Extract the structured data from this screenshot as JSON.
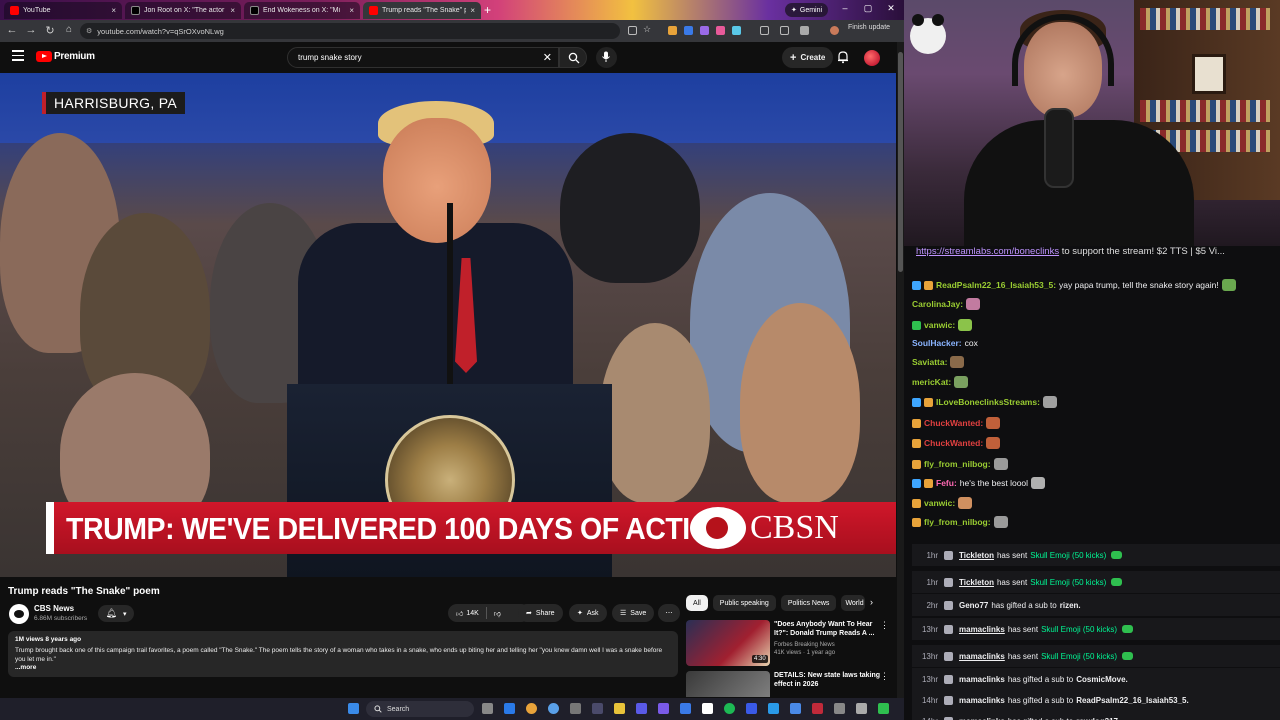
{
  "browser": {
    "tabs": [
      {
        "title": "YouTube",
        "favicon_color": "#ff0000"
      },
      {
        "title": "Jon Root on X: \"The actor",
        "favicon_color": "#000000"
      },
      {
        "title": "End Wokeness on X: \"Mi",
        "favicon_color": "#000000"
      },
      {
        "title": "Trump reads \"The Snake\" p",
        "favicon_color": "#ff0000"
      }
    ],
    "new_tab": "+",
    "gemini_label": "Gemini",
    "url": "youtube.com/watch?v=qSrOXvoNLwg",
    "finish_update": "Finish update"
  },
  "youtube": {
    "brand": "Premium",
    "search_query": "trump snake story",
    "create_label": "Create",
    "video": {
      "location": "HARRISBURG, PA",
      "lower_third": "TRUMP: WE'VE DELIVERED 100 DAYS OF ACTION",
      "network": "CBSN"
    },
    "title": "Trump reads \"The Snake\" poem",
    "channel": {
      "name": "CBS News",
      "subs": "6.86M subscribers"
    },
    "actions": {
      "likes": "14K",
      "share": "Share",
      "ask": "Ask",
      "save": "Save"
    },
    "description": {
      "meta": "1M views  8 years ago",
      "text": "Trump brought back one of this campaign trail favorites, a poem called \"The Snake.\" The poem tells the story of a woman who takes in a snake, who ends up biting her and telling her \"you knew damn well I was a snake before you let me in.\"",
      "more": "...more"
    },
    "chips": [
      "All",
      "Public speaking",
      "Politics News",
      "World"
    ],
    "recommendations": [
      {
        "title": "\"Does Anybody Want To Hear It?\": Donald Trump Reads A ...",
        "channel": "Forbes Breaking News",
        "views": "41K views · 1 year ago",
        "duration": "4:30"
      },
      {
        "title": "DETAILS: New state laws taking effect in 2026",
        "channel": "",
        "views": "",
        "duration": ""
      }
    ]
  },
  "taskbar": {
    "search_label": "Search"
  },
  "chat": {
    "pinned_link": "https://streamlabs.com/boneclinks",
    "pinned_rest": " to support the stream! $2 TTS | $5 Vi...",
    "messages": [
      {
        "user": "ReadPsalm22_16_Isaiah53_5",
        "color": "#9acd32",
        "text": "yay papa trump, tell the snake story again!",
        "badges": [
          "#3ea6ff",
          "#e8a33a"
        ]
      },
      {
        "user": "CarolinaJay",
        "color": "#9acd32",
        "text": "",
        "badges": []
      },
      {
        "user": "vanwic",
        "color": "#9acd32",
        "text": "",
        "badges": [
          "#2fbf4f"
        ]
      },
      {
        "user": "SoulHacker",
        "color": "#8ab4ff",
        "text": "cox",
        "badges": []
      },
      {
        "user": "Saviatta",
        "color": "#9acd32",
        "text": "",
        "badges": []
      },
      {
        "user": "mericKat",
        "color": "#9acd32",
        "text": "",
        "badges": []
      },
      {
        "user": "ILoveBoneclinksStreams",
        "color": "#9acd32",
        "text": "",
        "badges": [
          "#3ea6ff",
          "#e8a33a"
        ]
      },
      {
        "user": "ChuckWanted",
        "color": "#e04040",
        "text": "",
        "badges": [
          "#e8a33a"
        ]
      },
      {
        "user": "ChuckWanted",
        "color": "#e04040",
        "text": "",
        "badges": [
          "#e8a33a"
        ]
      },
      {
        "user": "fly_from_nilbog",
        "color": "#9acd32",
        "text": "",
        "badges": [
          "#e8a33a"
        ]
      },
      {
        "user": "Fefu",
        "color": "#ff69b4",
        "text": "he's the best loool",
        "badges": [
          "#3ea6ff",
          "#e8a33a"
        ]
      },
      {
        "user": "vanwic",
        "color": "#9acd32",
        "text": "",
        "badges": [
          "#e8a33a"
        ]
      },
      {
        "user": "fly_from_nilbog",
        "color": "#9acd32",
        "text": "",
        "badges": [
          "#e8a33a"
        ]
      }
    ],
    "events": [
      {
        "time": "1hr",
        "user": "Tickleton",
        "link": true,
        "pre": "has sent",
        "highlight": "Skull Emoji (50 kicks)",
        "after": "",
        "gem": true
      },
      {
        "time": "1hr",
        "user": "Tickleton",
        "link": true,
        "pre": "has sent",
        "highlight": "Skull Emoji (50 kicks)",
        "after": "",
        "gem": true
      },
      {
        "time": "2hr",
        "user": "Geno77",
        "link": false,
        "pre": "has gifted a sub to",
        "highlight": "",
        "after": "rizen.",
        "gem": false
      },
      {
        "time": "13hr",
        "user": "mamaclinks",
        "link": true,
        "pre": "has sent",
        "highlight": "Skull Emoji (50 kicks)",
        "after": "",
        "gem": true
      },
      {
        "time": "13hr",
        "user": "mamaclinks",
        "link": true,
        "pre": "has sent",
        "highlight": "Skull Emoji (50 kicks)",
        "after": "",
        "gem": true
      },
      {
        "time": "13hr",
        "user": "mamaclinks",
        "link": false,
        "pre": "has gifted a sub to",
        "highlight": "",
        "after": "CosmicMove.",
        "gem": false
      },
      {
        "time": "14hr",
        "user": "mamaclinks",
        "link": false,
        "pre": "has gifted a sub to",
        "highlight": "",
        "after": "ReadPsalm22_16_Isaiah53_5.",
        "gem": false
      },
      {
        "time": "14hr",
        "user": "mamaclinks",
        "link": false,
        "pre": "has gifted a sub to",
        "highlight": "",
        "after": "rawdog317.",
        "gem": false
      }
    ]
  }
}
